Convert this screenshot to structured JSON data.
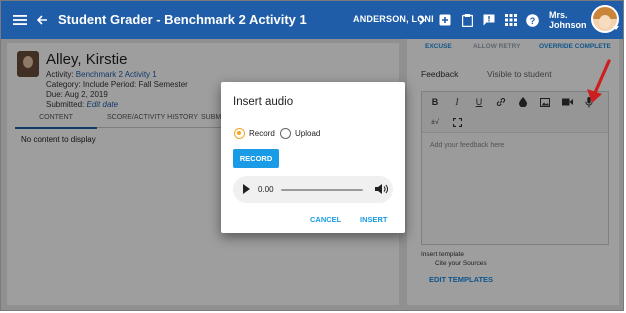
{
  "header": {
    "title": "Student Grader - Benchmark 2 Activity 1",
    "student": "ANDERSON, LONI",
    "user_first": "Mrs.",
    "user_last": "Johnson"
  },
  "student_panel": {
    "name": "Alley, Kirstie",
    "activity_label": "Activity:",
    "activity_value": "Benchmark 2 Activity 1",
    "category_line": "Category: Include   Period: Fall Semester",
    "due_line": "Due: Aug 2, 2019",
    "submitted_label": "Submitted:",
    "submitted_link": "Edit date",
    "tabs": [
      "CONTENT",
      "SCORE/ACTIVITY HISTORY",
      "SUBMI"
    ],
    "empty_text": "No content to display"
  },
  "feedback_panel": {
    "actions": [
      "EXCUSE",
      "ALLOW RETRY",
      "OVERRIDE COMPLETE"
    ],
    "label": "Feedback",
    "visibility": "Visible to student",
    "placeholder": "Add your feedback here",
    "template_label": "Insert template",
    "template_value": "Cite your Sources",
    "edit_templates": "EDIT TEMPLATES",
    "toolbar_icons": [
      "bold-icon",
      "italic-icon",
      "underline-icon",
      "link-icon",
      "color-icon",
      "image-icon",
      "video-icon",
      "microphone-icon",
      "math-icon",
      "fullscreen-icon"
    ]
  },
  "dialog": {
    "title": "Insert audio",
    "options": [
      "Record",
      "Upload"
    ],
    "selected_option": "Record",
    "record_button": "RECORD",
    "time": "0.00",
    "cancel": "CANCEL",
    "insert": "INSERT"
  },
  "colors": {
    "header_bg": "#1f5da8",
    "accent": "#1a9be6",
    "radio_selected": "#f5a623",
    "arrow": "#cc1f1f"
  }
}
